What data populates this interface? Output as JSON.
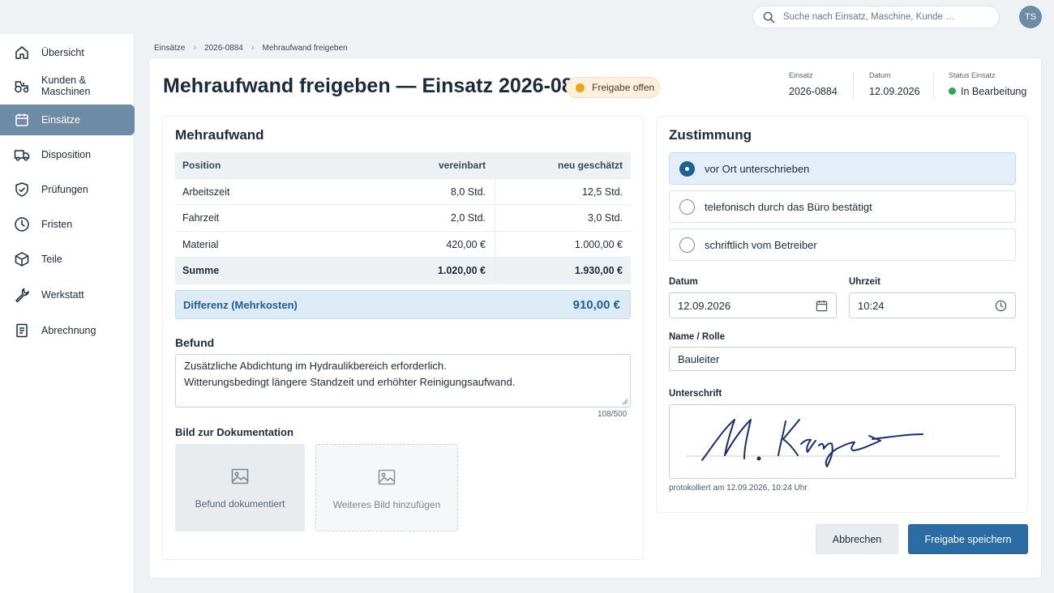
{
  "search": {
    "placeholder": "Suche nach Einsatz, Maschine, Kunde …"
  },
  "user": {
    "initials": "TS"
  },
  "sidebar": {
    "items": [
      {
        "label": "Übersicht",
        "icon": "home-icon",
        "active": false
      },
      {
        "label": "Kunden & Maschinen",
        "icon": "tractor-icon",
        "active": false
      },
      {
        "label": "Einsätze",
        "icon": "calendar-icon",
        "active": true
      },
      {
        "label": "Disposition",
        "icon": "truck-icon",
        "active": false
      },
      {
        "label": "Prüfungen",
        "icon": "shield-check-icon",
        "active": false
      },
      {
        "label": "Fristen",
        "icon": "clock-icon",
        "active": false
      },
      {
        "label": "Teile",
        "icon": "box-icon",
        "active": false
      },
      {
        "label": "Werkstatt",
        "icon": "wrench-icon",
        "active": false
      },
      {
        "label": "Abrechnung",
        "icon": "document-icon",
        "active": false
      }
    ]
  },
  "breadcrumb": [
    "Einsätze",
    "2026-0884",
    "Mehraufwand freigeben"
  ],
  "header": {
    "title": "Mehraufwand freigeben — Einsatz 2026-0884",
    "status_badge": "Freigabe offen",
    "meta": [
      {
        "label": "Einsatz",
        "value": "2026-0884"
      },
      {
        "label": "Datum",
        "value": "12.09.2026"
      },
      {
        "label": "Status Einsatz",
        "value": "In Bearbeitung"
      }
    ]
  },
  "colors": {
    "accent": "#2a6ca3",
    "sidebar_active": "#6e8ba5",
    "badge_dot": "#eba619",
    "status_green": "#2fa84f",
    "diff_text": "#1f5f93"
  },
  "mehraufwand": {
    "title": "Mehraufwand",
    "columns": [
      "Position",
      "vereinbart",
      "neu geschätzt"
    ],
    "rows": [
      {
        "position": "Arbeitszeit",
        "vereinbart": "8,0 Std.",
        "neu": "12,5 Std."
      },
      {
        "position": "Fahrzeit",
        "vereinbart": "2,0 Std.",
        "neu": "3,0 Std."
      },
      {
        "position": "Material",
        "vereinbart": "420,00 €",
        "neu": "1.000,00 €"
      }
    ],
    "summe": {
      "label": "Summe",
      "vereinbart": "1.020,00 €",
      "neu": "1.930,00 €"
    },
    "differenz": {
      "label": "Differenz (Mehrkosten)",
      "value": "910,00 €"
    }
  },
  "befund": {
    "title": "Befund",
    "text": "Zusätzliche Abdichtung im Hydraulikbereich erforderlich.\nWitterungsbedingt längere Standzeit und erhöhter Reinigungsaufwand.",
    "counter": "108/500"
  },
  "bilder": {
    "title": "Bild zur Dokumentation",
    "tiles": [
      {
        "label": "Befund dokumentiert",
        "icon": "image-icon"
      },
      {
        "label": "Weiteres Bild hinzufügen",
        "icon": "image-icon"
      }
    ]
  },
  "zustimmung": {
    "title": "Zustimmung",
    "options": [
      {
        "label": "vor Ort unterschrieben",
        "selected": true
      },
      {
        "label": "telefonisch durch das Büro bestätigt",
        "selected": false
      },
      {
        "label": "schriftlich vom Betreiber",
        "selected": false
      }
    ],
    "datum_label": "Datum",
    "datum_value": "12.09.2026",
    "uhrzeit_label": "Uhrzeit",
    "uhrzeit_value": "10:24",
    "name_label": "Name / Rolle",
    "name_value": "Bauleiter",
    "unterschrift_label": "Unterschrift",
    "signature_text": "M. Krüger",
    "protokoll": "protokolliert am 12.09.2026, 10:24 Uhr"
  },
  "actions": {
    "cancel": "Abbrechen",
    "save": "Freigabe speichern"
  }
}
